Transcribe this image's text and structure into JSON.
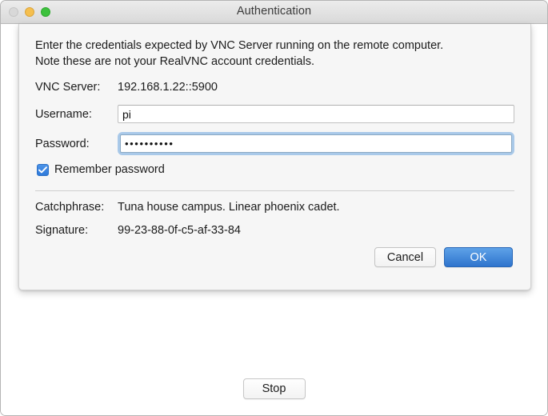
{
  "window": {
    "title": "Authentication",
    "traffic_lights": [
      {
        "name": "close",
        "color": "#d8d8d8",
        "enabled": false
      },
      {
        "name": "minimize",
        "color": "#f5bf4f",
        "enabled": true
      },
      {
        "name": "maximize",
        "color": "#3dc13d",
        "enabled": true
      }
    ]
  },
  "dialog": {
    "intro_line1": "Enter the credentials expected by VNC Server running on the remote computer.",
    "intro_line2": "Note these are not your RealVNC account credentials.",
    "server": {
      "label": "VNC Server:",
      "value": "192.168.1.22::5900"
    },
    "username": {
      "label": "Username:",
      "value": "pi",
      "placeholder": ""
    },
    "password": {
      "label": "Password:",
      "value": "••••••••••",
      "placeholder": "",
      "focused": true
    },
    "remember": {
      "label": "Remember password",
      "checked": true,
      "check_color": "#3079da"
    },
    "catchphrase": {
      "label": "Catchphrase:",
      "value": "Tuna house campus. Linear phoenix cadet."
    },
    "signature": {
      "label": "Signature:",
      "value": "99-23-88-0f-c5-af-33-84"
    },
    "buttons": {
      "cancel": "Cancel",
      "ok": "OK",
      "ok_color": "#2f74cd"
    }
  },
  "footer": {
    "stop_label": "Stop"
  }
}
